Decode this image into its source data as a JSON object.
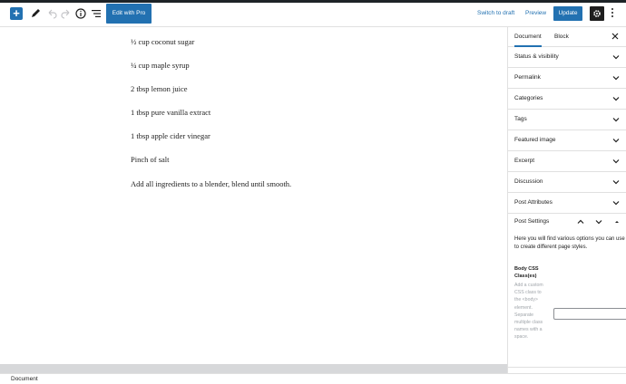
{
  "toolbar": {
    "add_icon": "plus-icon",
    "edit_pro_label": "Edit with Pro",
    "switch_draft_label": "Switch to draft",
    "preview_label": "Preview",
    "update_label": "Update"
  },
  "content": {
    "paragraphs": [
      "½ cup coconut sugar",
      "¼ cup maple syrup",
      "2 tbsp lemon juice",
      "1 tbsp pure vanilla extract",
      "1 tbsp apple cider vinegar",
      "Pinch of salt",
      "Add all ingredients to a blender, blend until smooth."
    ]
  },
  "sidebar": {
    "tabs": [
      "Document",
      "Block"
    ],
    "panels": [
      "Status & visibility",
      "Permalink",
      "Categories",
      "Tags",
      "Featured image",
      "Excerpt",
      "Discussion",
      "Post Attributes"
    ],
    "post_settings": {
      "title": "Post Settings",
      "description": "Here you will find various options you can use to create different page styles.",
      "css_label": "Body CSS Class(es)",
      "css_help": "Add a custom CSS class to the <body> element. Separate multiple class names with a space.",
      "css_value": ""
    }
  },
  "footer": {
    "label": "Document"
  },
  "colors": {
    "accent": "#2271b1",
    "dark": "#1e1e1e"
  }
}
